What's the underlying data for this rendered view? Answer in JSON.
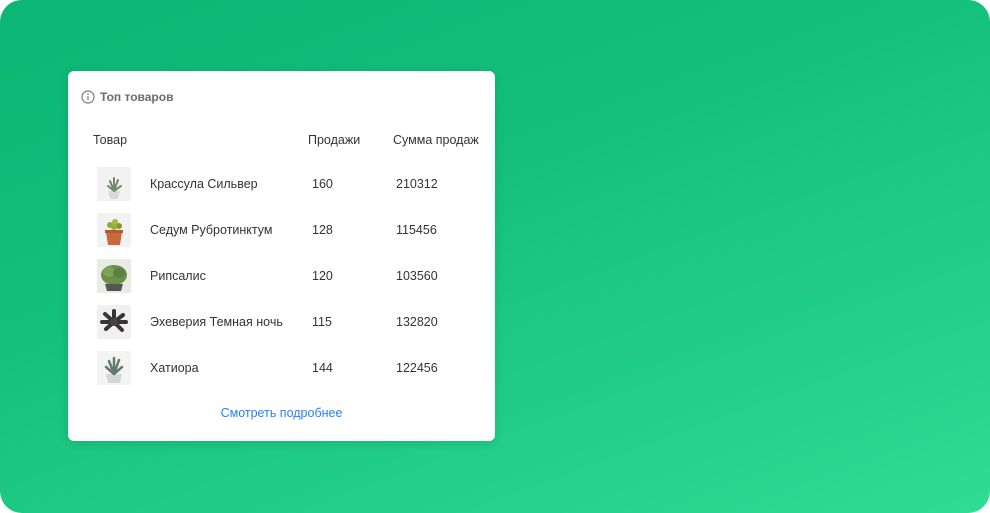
{
  "widget": {
    "title": "Топ товаров",
    "info_icon": "info-icon",
    "columns": {
      "product": "Товар",
      "sales": "Продажи",
      "sum": "Сумма продаж"
    },
    "rows": [
      {
        "name": "Крассула Сильвер",
        "sales": "160",
        "sum": "210312",
        "thumb": "plant-photo"
      },
      {
        "name": "Седум Рубротинктум",
        "sales": "128",
        "sum": "115456",
        "thumb": "plant-photo"
      },
      {
        "name": "Рипсалис",
        "sales": "120",
        "sum": "103560",
        "thumb": "plant-photo"
      },
      {
        "name": "Эхеверия Темная ночь",
        "sales": "115",
        "sum": "132820",
        "thumb": "plant-photo"
      },
      {
        "name": "Хатиора",
        "sales": "144",
        "sum": "122456",
        "thumb": "plant-photo"
      }
    ],
    "more_link": "Смотреть подробнее"
  },
  "colors": {
    "background_gradient_start": "#0bb573",
    "background_gradient_end": "#2fdc93",
    "link": "#2a7ff5",
    "card": "#ffffff"
  }
}
